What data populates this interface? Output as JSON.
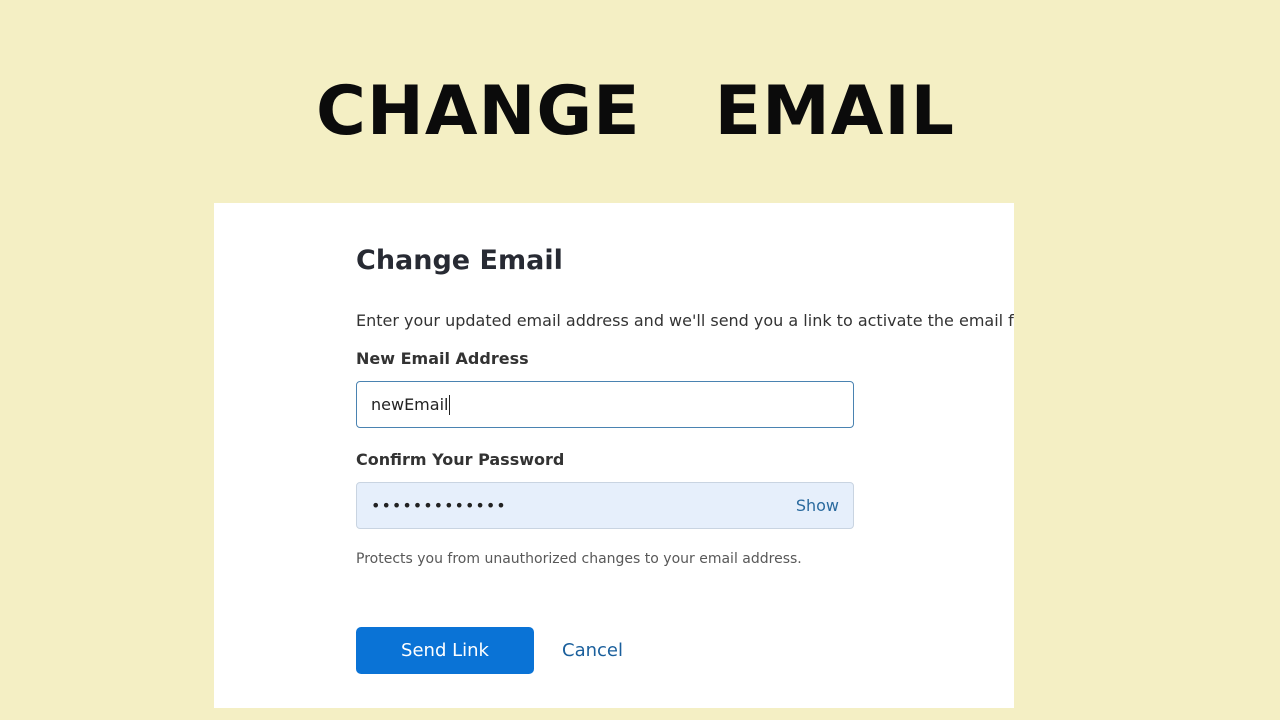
{
  "banner": {
    "title": "CHANGE   EMAIL"
  },
  "form": {
    "title": "Change Email",
    "description": "Enter your updated email address and we'll send you a link to activate the email for yo",
    "email_label": "New Email Address",
    "email_value": "newEmail",
    "password_label": "Confirm Your Password",
    "password_value": "•••••••••••••",
    "show_label": "Show",
    "hint": "Protects you from unauthorized changes to your email address.",
    "send_label": "Send Link",
    "cancel_label": "Cancel"
  },
  "colors": {
    "page_background": "#f4efc4",
    "card_background": "#ffffff",
    "primary_button": "#0a73d6",
    "link": "#1a5f9c",
    "focused_border": "#4a83b1",
    "password_field_background": "#e6effb"
  }
}
